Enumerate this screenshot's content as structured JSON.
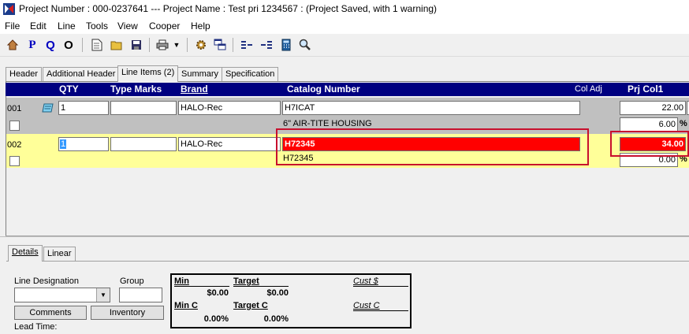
{
  "window": {
    "title": "Project Number : 000-0237641 --- Project Name : Test pri 1234567 : (Project Saved, with 1 warning)"
  },
  "menu": [
    "File",
    "Edit",
    "Line",
    "Tools",
    "View",
    "Cooper",
    "Help"
  ],
  "toolbar": {
    "p_label": "P",
    "q_label": "Q",
    "o_label": "O"
  },
  "tabs": [
    "Header",
    "Additional Header",
    "Line Items (2)",
    "Summary",
    "Specification"
  ],
  "grid": {
    "headers": {
      "qty": "QTY",
      "type_marks": "Type Marks",
      "brand": "Brand",
      "catalog": "Catalog Number",
      "col_adj": "Col Adj",
      "prj_col1": "Prj Col1"
    },
    "rows": [
      {
        "line": "001",
        "qty": "1",
        "type_marks": "",
        "brand": "HALO-Rec",
        "catalog": "H7ICAT",
        "description": "6\" AIR-TITE HOUSING",
        "price": "22.00",
        "pct": "6.00",
        "pct_sign": "%"
      },
      {
        "line": "002",
        "qty": "1",
        "type_marks": "",
        "brand": "HALO-Rec",
        "catalog": "H72345",
        "description": "H72345",
        "price": "34.00",
        "pct": "0.00",
        "pct_sign": "%"
      }
    ]
  },
  "bottom_tabs": [
    "Details",
    "Linear"
  ],
  "details": {
    "line_designation_label": "Line Designation",
    "group_label": "Group",
    "comments_button": "Comments",
    "inventory_button": "Inventory",
    "lead_time_label": "Lead Time:"
  },
  "costs": {
    "min_label": "Min",
    "min_value": "$0.00",
    "target_label": "Target",
    "target_value": "$0.00",
    "min_c_label": "Min C",
    "min_c_value": "0.00%",
    "target_c_label": "Target C",
    "target_c_value": "0.00%",
    "cust_dollar_label": "Cust $",
    "cust_c_label": "Cust C"
  },
  "colors": {
    "header_bg": "#000080",
    "row_warning": "#ffff99",
    "error_red": "#ff0000",
    "annotation": "#c8102e"
  }
}
